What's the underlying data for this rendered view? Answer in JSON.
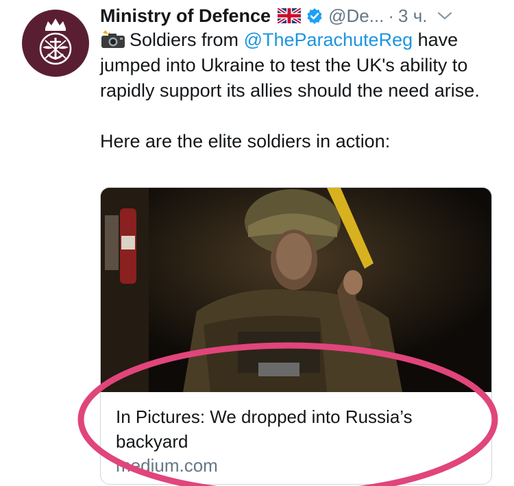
{
  "tweet": {
    "author_name": "Ministry of Defence",
    "handle": "@De...",
    "separator": "·",
    "timestamp": "3 ч.",
    "text_mention": "@TheParachuteReg",
    "text_soldiers": "Soldiers from ",
    "text_rest": " have jumped into Ukraine to test the UK's ability to rapidly support its allies should the need arise.",
    "text_second": "Here are the elite soldiers in action:"
  },
  "card": {
    "title": "In Pictures: We dropped into Russia’s backyard",
    "domain": "medium.com"
  },
  "icons": {
    "flag": "uk-flag-icon",
    "verified": "verified-badge-icon",
    "chevron": "chevron-down-icon",
    "camera": "camera-flash-icon"
  },
  "colors": {
    "avatar_bg": "#5a1e33",
    "link": "#1b95e0",
    "verified": "#1da1f2",
    "highlight_circle": "#e0457b"
  }
}
